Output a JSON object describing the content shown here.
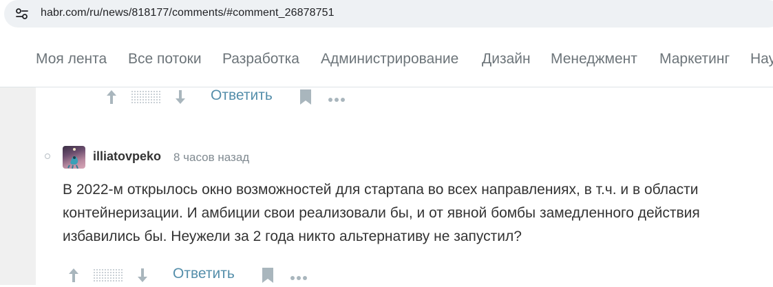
{
  "browser": {
    "url": "habr.com/ru/news/818177/comments/#comment_26878751",
    "site_info_icon": "tune-icon"
  },
  "nav": {
    "items": [
      "Моя лента",
      "Все потоки",
      "Разработка",
      "Администрирование",
      "Дизайн",
      "Менеджмент",
      "Маркетинг",
      "Нау"
    ]
  },
  "prev_comment_actions": {
    "reply_label": "Ответить"
  },
  "comment": {
    "author": "illiatovpeko",
    "time": "8 часов назад",
    "text": "В 2022-м открылось окно возможностей для стартапа во всех направлениях, в т.ч. и в области контейнеризации. И амбиции свои реализовали бы, и от явной бомбы замедленного действия избавились бы. Неужели за 2 года никто альтернативу не запустил?",
    "reply_label": "Ответить"
  },
  "colors": {
    "link": "#548eaa",
    "nav_text": "#6c7479",
    "icon": "#a9b6bd"
  }
}
